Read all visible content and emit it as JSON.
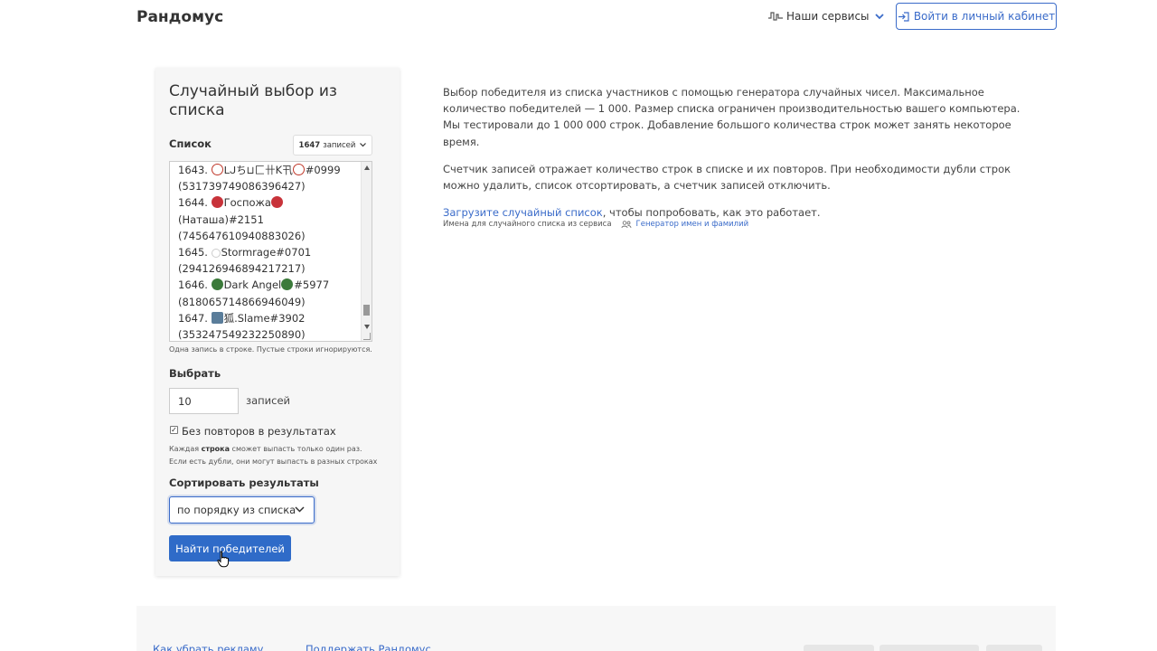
{
  "header": {
    "logo": "Рандомус",
    "services_label": "Наши сервисы",
    "login_label": "Войти в личный кабинет"
  },
  "card": {
    "title": "Случайный выбор из списка",
    "list_label": "Список",
    "count_value": "1647",
    "count_unit": "записей",
    "list_lines": [
      {
        "prefix": "1643. ",
        "icon": "skull",
        "text": "ᒪᒍち⊔匚卄K卂",
        "icon2": "skull",
        "tail": "#0999"
      },
      {
        "prefix": "(531739749086396427)",
        "icon": "",
        "text": "",
        "icon2": "",
        "tail": ""
      },
      {
        "prefix": "1644. ",
        "icon": "devil",
        "text": "Госпожа",
        "icon2": "devil",
        "tail": ""
      },
      {
        "prefix": "(Наташа)#2151",
        "icon": "",
        "text": "",
        "icon2": "",
        "tail": ""
      },
      {
        "prefix": "(745647610940883026)",
        "icon": "",
        "text": "",
        "icon2": "",
        "tail": ""
      },
      {
        "prefix": "1645. ",
        "icon": "white-heart",
        "text": "Stormrage#0701",
        "icon2": "",
        "tail": ""
      },
      {
        "prefix": "(294126946894217217)",
        "icon": "",
        "text": "",
        "icon2": "",
        "tail": ""
      },
      {
        "prefix": "1646. ",
        "icon": "rose",
        "text": "Dark Angel",
        "icon2": "rose",
        "tail": "#5977"
      },
      {
        "prefix": "(818065714866946049)",
        "icon": "",
        "text": "",
        "icon2": "",
        "tail": ""
      },
      {
        "prefix": "1647. ",
        "icon": "ghost-box",
        "text": "狐.Slame#3902",
        "icon2": "",
        "tail": ""
      },
      {
        "prefix": "(353247549232250890)",
        "icon": "",
        "text": "",
        "icon2": "",
        "tail": ""
      }
    ],
    "list_hint": "Одна запись в строке. Пустые строки игнорируются.",
    "choose_label": "Выбрать",
    "choose_value": "10",
    "choose_unit": "записей",
    "no_repeat_checked": true,
    "no_repeat_label": "Без повторов в результатах",
    "no_repeat_hint_pre": "Каждая ",
    "no_repeat_hint_bold": "строка",
    "no_repeat_hint_post": " сможет выпасть только один раз.",
    "no_repeat_hint_line2": "Если есть дубли, они могут выпасть в разных строках",
    "sort_label": "Сортировать результаты",
    "sort_value": "по порядку из списка",
    "find_button": "Найти победителей"
  },
  "description": {
    "p1": "Выбор победителя из списка участников с помощью генератора случайных чисел. Максимальное количество победителей — 1 000. Размер списка ограничен производительностью вашего компьютера. Мы тестировали до 1 000 000 строк. Добавление большого количества строк может занять некоторое время.",
    "p2": "Счетчик записей отражает количество строк в списке и их повторов. При необходимости дубли строк можно удалить, список отсортировать, а счетчик записей отключить.",
    "p3_link": "Загрузите случайный список",
    "p3_rest": ", чтобы попробовать, как это работает.",
    "source_text": "Имена для случайного списка из сервиса",
    "source_link": "Генератор имен и фамилий"
  },
  "footer": {
    "link1": "Как убрать рекламу",
    "link2": "Поддержать Рандомус"
  },
  "colors": {
    "accent": "#3a6bc9",
    "button": "#2f6bc8",
    "card_bg": "#f6f6f6"
  }
}
